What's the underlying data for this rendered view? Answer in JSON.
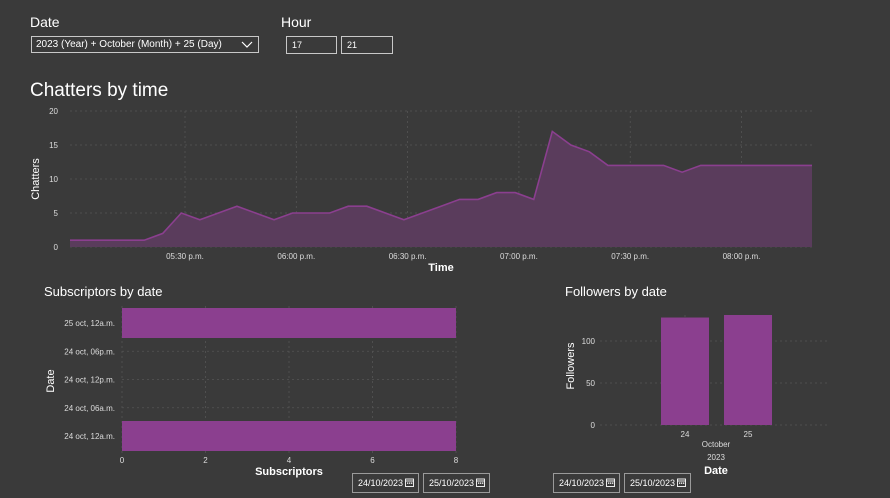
{
  "filters": {
    "date_label": "Date",
    "date_value": "2023 (Year) + October (Month) + 25 (Day)",
    "hour_label": "Hour",
    "hour_from": "17",
    "hour_to": "21"
  },
  "colors": {
    "accent": "#8b3f8f",
    "area_fill": "#5a3c5c",
    "background": "#3a3a3a"
  },
  "chatters": {
    "title": "Chatters by time",
    "xlabel": "Time",
    "ylabel": "Chatters"
  },
  "subscribers": {
    "title": "Subscriptors by date",
    "xlabel": "Subscriptors",
    "ylabel": "Date",
    "date_from": "24/10/2023",
    "date_to": "25/10/2023"
  },
  "followers": {
    "title": "Followers by date",
    "xlabel": "Date",
    "ylabel": "Followers",
    "month_label": "October",
    "year_label": "2023",
    "date_from": "24/10/2023",
    "date_to": "25/10/2023"
  },
  "chart_data": [
    {
      "type": "area",
      "title": "Chatters by time",
      "xlabel": "Time",
      "ylabel": "Chatters",
      "x_ticks": [
        "05:30 p.m.",
        "06:00 p.m.",
        "06:30 p.m.",
        "07:00 p.m.",
        "07:30 p.m.",
        "08:00 p.m."
      ],
      "x_tick_minutes": [
        1050,
        1080,
        1110,
        1140,
        1170,
        1200
      ],
      "x_minutes": [
        1019,
        1024,
        1029,
        1034,
        1039,
        1044,
        1049,
        1054,
        1059,
        1064,
        1069,
        1074,
        1079,
        1084,
        1089,
        1094,
        1099,
        1104,
        1109,
        1114,
        1119,
        1124,
        1129,
        1134,
        1139,
        1144,
        1149,
        1154,
        1159,
        1164,
        1169,
        1174,
        1179,
        1184,
        1189,
        1194,
        1199,
        1204,
        1209,
        1214,
        1219
      ],
      "y": [
        1,
        1,
        1,
        1,
        1,
        2,
        5,
        4,
        5,
        6,
        5,
        4,
        5,
        5,
        5,
        6,
        6,
        5,
        4,
        5,
        6,
        7,
        7,
        8,
        8,
        7,
        17,
        15,
        14,
        12,
        12,
        12,
        12,
        11,
        12,
        12,
        12,
        12,
        12,
        12,
        12
      ],
      "y_ticks": [
        0,
        5,
        10,
        15,
        20
      ],
      "ylim": [
        0,
        20
      ],
      "xlim": [
        1019,
        1219
      ],
      "grid": true
    },
    {
      "type": "bar",
      "orientation": "horizontal",
      "title": "Subscriptors by date",
      "xlabel": "Subscriptors",
      "ylabel": "Date",
      "categories": [
        "25 oct, 12a.m.",
        "24 oct, 06p.m.",
        "24 oct, 12p.m.",
        "24 oct, 06a.m.",
        "24 oct, 12a.m."
      ],
      "values": [
        8,
        0,
        0,
        0,
        8
      ],
      "x_ticks": [
        0,
        2,
        4,
        6,
        8
      ],
      "xlim": [
        0,
        8
      ],
      "grid": true
    },
    {
      "type": "bar",
      "title": "Followers by date",
      "xlabel": "Date",
      "ylabel": "Followers",
      "categories": [
        "24",
        "25"
      ],
      "values": [
        128,
        131
      ],
      "y_ticks": [
        0,
        50,
        100
      ],
      "ylim": [
        0,
        131
      ],
      "grid": true
    }
  ]
}
